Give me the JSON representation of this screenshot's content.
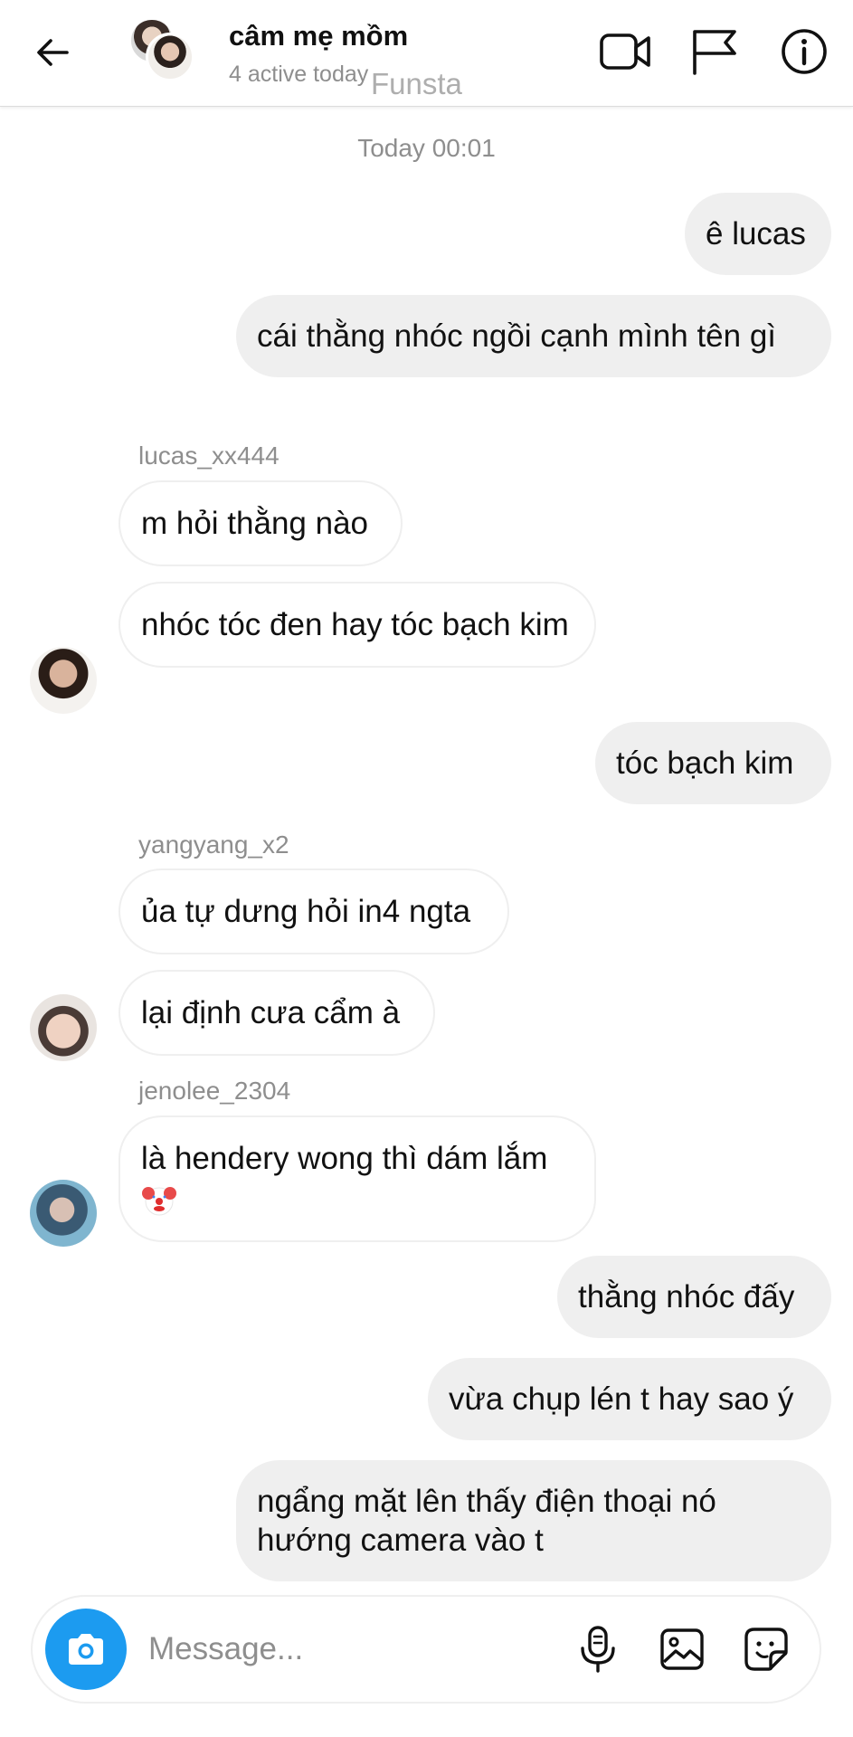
{
  "header": {
    "title": "câm mẹ mồm",
    "status": "4 active today",
    "watermark": "Funsta"
  },
  "conversation": {
    "timestamp": "Today 00:01",
    "senders": {
      "lucas": "lucas_xx444",
      "yang": "yangyang_x2",
      "jeno": "jenolee_2304"
    },
    "messages": [
      {
        "text": "ê lucas"
      },
      {
        "text": "cái thằng nhóc ngồi cạnh mình tên gì"
      },
      {
        "text": "m hỏi thằng nào"
      },
      {
        "text": "nhóc tóc đen hay tóc bạch kim"
      },
      {
        "text": "tóc bạch kim"
      },
      {
        "text": "ủa tự dưng hỏi in4 ngta"
      },
      {
        "text": "lại định cưa cẩm à"
      },
      {
        "text": "là hendery wong thì dám lắm"
      },
      {
        "text": "thằng nhóc đấy"
      },
      {
        "text": "vừa chụp lén t hay sao ý"
      },
      {
        "text": "ngẩng mặt lên thấy điện thoại nó hướng camera vào t"
      }
    ]
  },
  "composer": {
    "placeholder": "Message..."
  },
  "icons": {
    "back": "arrow-left-icon",
    "video": "video-camera-icon",
    "report": "flag-icon",
    "info": "info-icon",
    "camera": "camera-icon",
    "mic": "microphone-icon",
    "gallery": "image-icon",
    "sticker": "sticker-icon",
    "emoji": "clown-face-emoji"
  },
  "colors": {
    "accent": "#1c9bf0",
    "outgoing_bubble": "#efefef",
    "muted_text": "#8e8e8e"
  }
}
